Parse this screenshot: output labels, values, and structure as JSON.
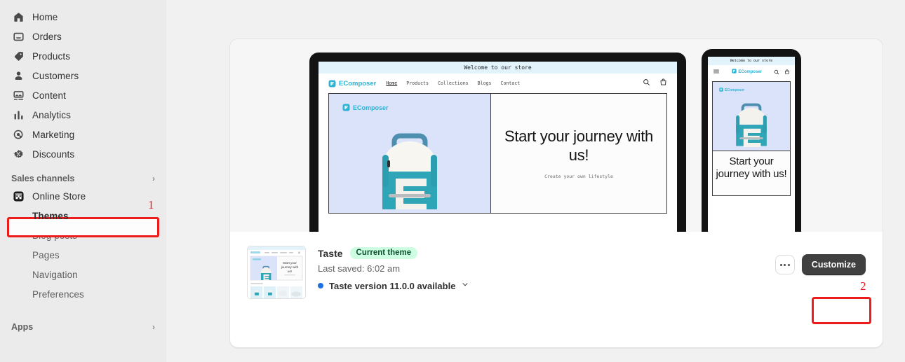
{
  "sidebar": {
    "items": [
      {
        "label": "Home",
        "icon": "home-icon"
      },
      {
        "label": "Orders",
        "icon": "orders-icon"
      },
      {
        "label": "Products",
        "icon": "products-tag-icon"
      },
      {
        "label": "Customers",
        "icon": "customers-person-icon"
      },
      {
        "label": "Content",
        "icon": "content-image-icon"
      },
      {
        "label": "Analytics",
        "icon": "analytics-bars-icon"
      },
      {
        "label": "Marketing",
        "icon": "marketing-target-icon"
      },
      {
        "label": "Discounts",
        "icon": "discounts-percent-icon"
      }
    ],
    "sales_channels": {
      "label": "Sales channels",
      "chevron": "›"
    },
    "online_store": {
      "label": "Online Store",
      "icon": "store-icon"
    },
    "sub_items": [
      {
        "label": "Themes",
        "active": true
      },
      {
        "label": "Blog posts",
        "active": false
      },
      {
        "label": "Pages",
        "active": false
      },
      {
        "label": "Navigation",
        "active": false
      },
      {
        "label": "Preferences",
        "active": false
      }
    ],
    "apps": {
      "label": "Apps",
      "chevron": "›"
    }
  },
  "preview": {
    "desktop": {
      "announcement": "Welcome to our store",
      "brand": "EComposer",
      "links": [
        "Home",
        "Products",
        "Collections",
        "Blogs",
        "Contact"
      ],
      "hero_brand": "EComposer",
      "heading": "Start your journey with us!",
      "subheading": "Create your own lifestyle",
      "search_icon": "search-icon",
      "cart_icon": "cart-icon"
    },
    "mobile": {
      "announcement": "Welcome to our store",
      "brand": "EComposer",
      "hero_brand": "EComposer",
      "heading": "Start your journey with us!",
      "menu_icon": "hamburger-menu-icon",
      "search_icon": "search-icon",
      "cart_icon": "cart-icon"
    }
  },
  "theme_card": {
    "name": "Taste",
    "badge": "Current theme",
    "last_saved": "Last saved: 6:02 am",
    "version_text": "Taste version 11.0.0 available",
    "version_chevron": "⌄",
    "more_label": "•••",
    "customize_label": "Customize"
  },
  "annotations": {
    "step1": "1",
    "step2": "2"
  },
  "colors": {
    "accent_blue": "#1f6fde",
    "badge_bg": "#cdfee1",
    "badge_text": "#0c5132",
    "brand_teal": "#2ab3d4",
    "highlight_red": "#ee1b1b",
    "button_dark": "#404040",
    "sidebar_bg": "#ebebeb",
    "hero_bg": "#dbe3fb"
  }
}
